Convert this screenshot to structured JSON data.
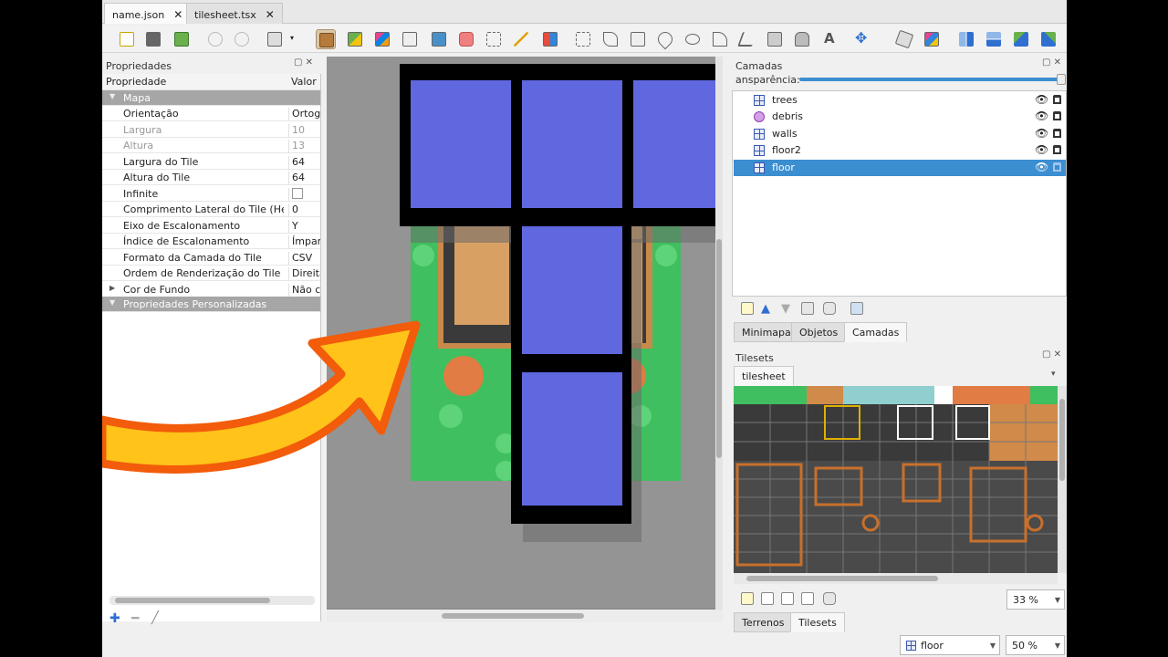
{
  "tabs": [
    {
      "label": "name.json",
      "active": true
    },
    {
      "label": "tilesheet.tsx",
      "active": false
    }
  ],
  "close_glyph": "✕",
  "toolbar_icons": [
    "new-map-icon",
    "open-icon",
    "save-icon",
    "undo-icon",
    "redo-icon",
    "command-icon",
    "stamp-brush-icon",
    "terrain-brush-icon",
    "wang-brush-icon",
    "bucket-fill-icon",
    "shape-fill-icon",
    "eraser-icon",
    "rectangle-select-icon",
    "magic-wand-icon",
    "select-same-tile-icon",
    "select-objects-icon",
    "edit-polygons-icon",
    "insert-rectangle-icon",
    "insert-point-icon",
    "insert-ellipse-icon",
    "insert-polygon-icon",
    "insert-polyline-icon",
    "insert-tile-icon",
    "insert-template-icon",
    "insert-text-icon",
    "move-icon",
    "random-mode-icon",
    "wang-fill-mode-icon",
    "flip-horizontal-icon",
    "flip-vertical-icon",
    "rotate-left-icon",
    "rotate-right-icon"
  ],
  "properties": {
    "title": "Propriedades",
    "col_property": "Propriedade",
    "col_value": "Valor",
    "group_map": "Mapa",
    "rows": [
      {
        "key": "Orientação",
        "value": "Ortogo",
        "disabled": false
      },
      {
        "key": "Largura",
        "value": "10",
        "disabled": true
      },
      {
        "key": "Altura",
        "value": "13",
        "disabled": true
      },
      {
        "key": "Largura do Tile",
        "value": "64",
        "disabled": false
      },
      {
        "key": "Altura do Tile",
        "value": "64",
        "disabled": false
      },
      {
        "key": "Infinite",
        "value": "",
        "disabled": false
      },
      {
        "key": "Comprimento Lateral do Tile (Hex)",
        "value": "0",
        "disabled": false
      },
      {
        "key": "Eixo de Escalonamento",
        "value": "Y",
        "disabled": false
      },
      {
        "key": "Índice de Escalonamento",
        "value": "Ímpar",
        "disabled": false
      },
      {
        "key": "Formato da Camada do Tile",
        "value": "CSV",
        "disabled": false
      },
      {
        "key": "Ordem de Renderização do Tile",
        "value": "Direita",
        "disabled": false
      },
      {
        "key": "Cor de Fundo",
        "value": "Não co",
        "disabled": false
      }
    ],
    "group_custom": "Propriedades Personalizadas"
  },
  "layers_panel": {
    "title": "Camadas",
    "opacity_label": "ansparência:",
    "opacity": 1.0,
    "layers": [
      {
        "name": "trees",
        "selected": false,
        "type": "tile"
      },
      {
        "name": "debris",
        "selected": false,
        "type": "object"
      },
      {
        "name": "walls",
        "selected": false,
        "type": "tile"
      },
      {
        "name": "floor2",
        "selected": false,
        "type": "tile"
      },
      {
        "name": "floor",
        "selected": true,
        "type": "tile"
      }
    ],
    "eye_glyph": "👁"
  },
  "mid_tabs": [
    {
      "label": "Minimapa",
      "active": false
    },
    {
      "label": "Objetos",
      "active": false
    },
    {
      "label": "Camadas",
      "active": true
    }
  ],
  "tilesets_panel": {
    "title": "Tilesets",
    "tab": "tilesheet",
    "zoom": "33 %"
  },
  "bottom_tabs": [
    {
      "label": "Terrenos",
      "active": false
    },
    {
      "label": "Tilesets",
      "active": true
    }
  ],
  "status": {
    "layer_combo": "floor",
    "zoom": "50 %"
  },
  "colors": {
    "selection": "#3b8ed0",
    "grass": "#3fbf5f",
    "tile_blue": "#6068df",
    "arrow_fill": "#ffc31a",
    "arrow_stroke": "#f25c0a"
  }
}
